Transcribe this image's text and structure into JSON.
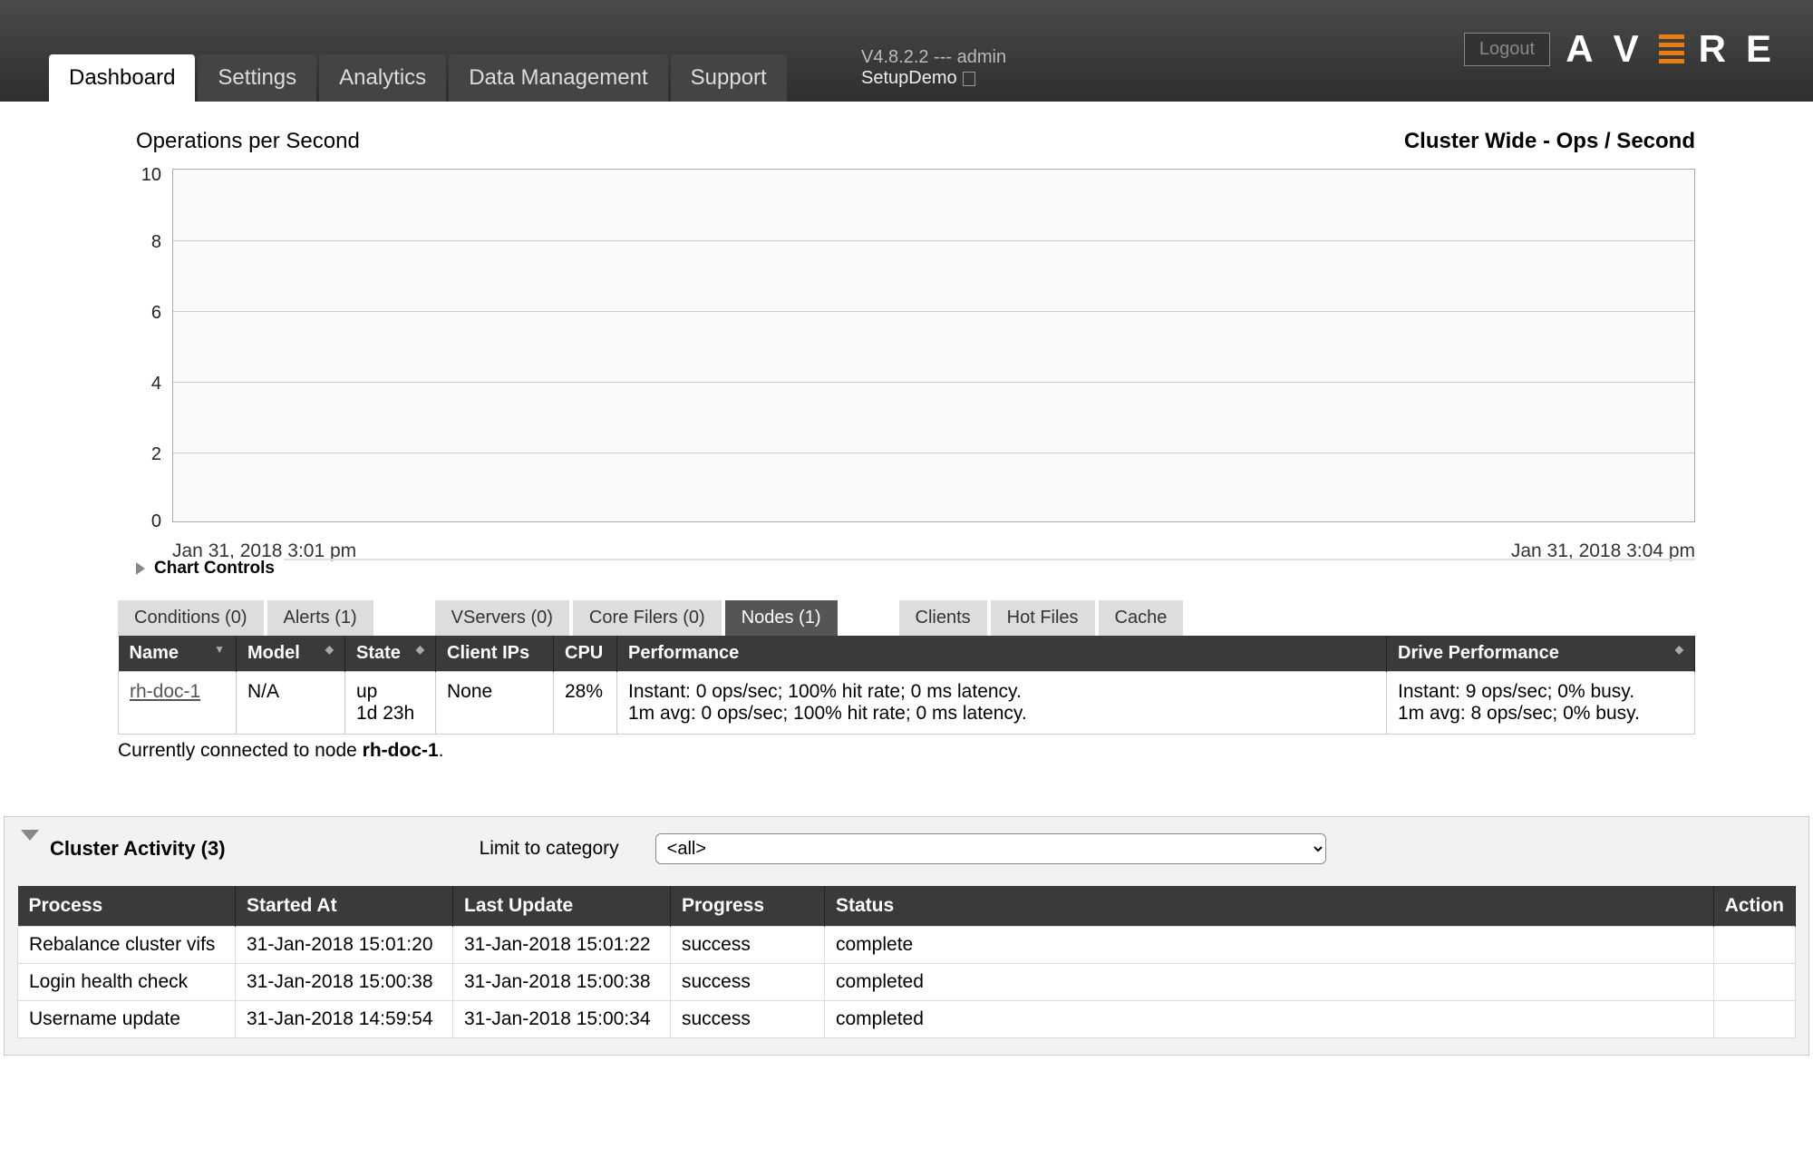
{
  "header": {
    "logout_label": "Logout",
    "version": "V4.8.2.2 --- admin",
    "cluster_name": "SetupDemo",
    "logo_letters": [
      "A",
      "V",
      "E",
      "R",
      "E"
    ]
  },
  "tabs": [
    "Dashboard",
    "Settings",
    "Analytics",
    "Data Management",
    "Support"
  ],
  "active_tab": "Dashboard",
  "chart": {
    "title": "Operations per Second",
    "subtitle": "Cluster Wide - Ops / Second",
    "yticks": [
      "10",
      "8",
      "6",
      "4",
      "2",
      "0"
    ],
    "xleft": "Jan 31, 2018 3:01 pm",
    "xright": "Jan 31, 2018 3:04 pm",
    "controls_label": "Chart Controls"
  },
  "chart_data": {
    "type": "line",
    "title": "Operations per Second",
    "xlabel": "",
    "ylabel": "Operations per Second",
    "ylim": [
      0,
      10
    ],
    "x_start": "Jan 31, 2018 3:01 pm",
    "x_end": "Jan 31, 2018 3:04 pm",
    "series": [
      {
        "name": "Cluster Wide - Ops / Second",
        "values": []
      }
    ]
  },
  "inner_tabs": {
    "left": [
      "Conditions (0)",
      "Alerts (1)"
    ],
    "right_group": [
      "VServers (0)",
      "Core Filers (0)",
      "Nodes (1)"
    ],
    "right_group_active": "Nodes (1)",
    "far": [
      "Clients",
      "Hot Files",
      "Cache"
    ]
  },
  "nodes_table": {
    "headers": [
      "Name",
      "Model",
      "State",
      "Client IPs",
      "CPU",
      "Performance",
      "Drive Performance"
    ],
    "row": {
      "name": "rh-doc-1",
      "model": "N/A",
      "state_line1": "up",
      "state_line2": "1d 23h",
      "client_ips": "None",
      "cpu": "28%",
      "perf_line1": "Instant:  0 ops/sec; 100% hit rate; 0 ms latency.",
      "perf_line2": "1m avg: 0 ops/sec; 100% hit rate; 0 ms latency.",
      "dperf_line1": "Instant:   9 ops/sec;  0% busy.",
      "dperf_line2": "1m avg:  8 ops/sec;  0% busy."
    },
    "note_prefix": "Currently connected to node ",
    "note_node": "rh-doc-1",
    "note_suffix": "."
  },
  "activity": {
    "title": "Cluster Activity (3)",
    "limit_label": "Limit to category",
    "select_value": "<all>",
    "headers": [
      "Process",
      "Started At",
      "Last Update",
      "Progress",
      "Status",
      "Action"
    ],
    "rows": [
      {
        "process": "Rebalance cluster vifs",
        "started": "31-Jan-2018 15:01:20",
        "updated": "31-Jan-2018 15:01:22",
        "progress": "success",
        "status": "complete",
        "action": ""
      },
      {
        "process": "Login health check",
        "started": "31-Jan-2018 15:00:38",
        "updated": "31-Jan-2018 15:00:38",
        "progress": "success",
        "status": "completed",
        "action": ""
      },
      {
        "process": "Username update",
        "started": "31-Jan-2018 14:59:54",
        "updated": "31-Jan-2018 15:00:34",
        "progress": "success",
        "status": "completed",
        "action": ""
      }
    ]
  }
}
